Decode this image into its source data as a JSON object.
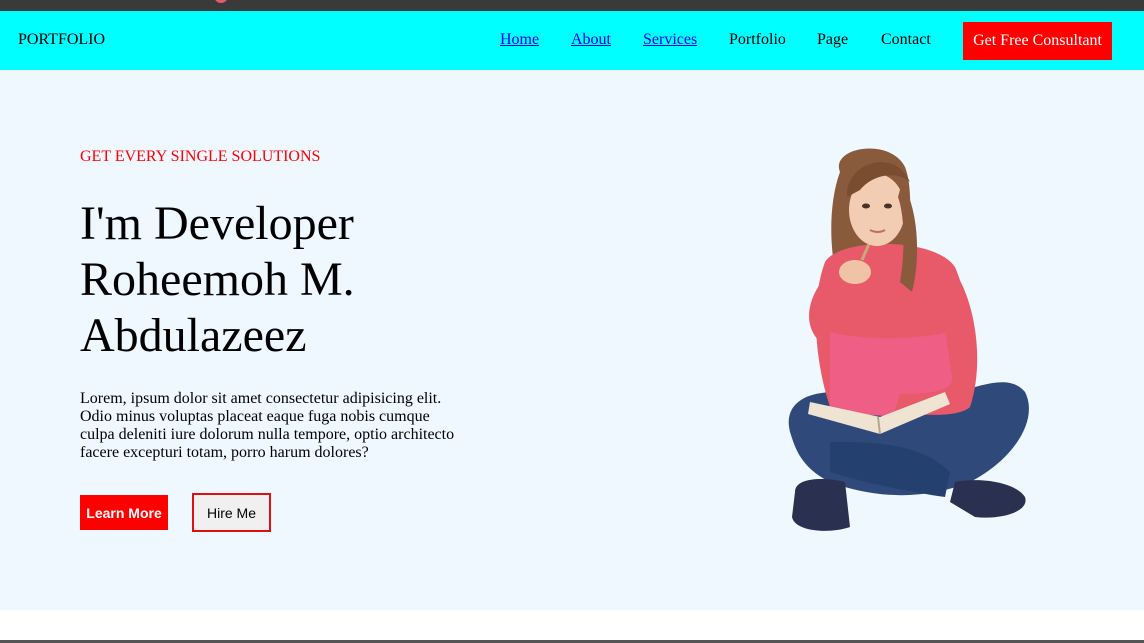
{
  "nav": {
    "brand": "PORTFOLIO",
    "items": [
      {
        "label": "Home"
      },
      {
        "label": "About"
      },
      {
        "label": "Services"
      },
      {
        "label": "Portfolio"
      },
      {
        "label": "Page"
      },
      {
        "label": "Contact"
      }
    ],
    "cta": "Get Free Consultant"
  },
  "hero": {
    "eyebrow": "GET EVERY SINGLE SOLUTIONS",
    "heading_lines": [
      "I'm Developer",
      "Roheemoh M.",
      "Abdulazeez"
    ],
    "paragraph": "Lorem, ipsum dolor sit amet consectetur adipisicing elit. Odio minus voluptas placeat eaque fuga nobis cumque culpa deleniti iure dolorum nulla tempore, optio architecto facere excepturi totam, porro harum dolores?",
    "learn_more": "Learn More",
    "hire_me": "Hire Me"
  },
  "colors": {
    "nav_bg": "#00ffff",
    "accent": "#ff0000",
    "hero_bg": "#eff7ff"
  }
}
